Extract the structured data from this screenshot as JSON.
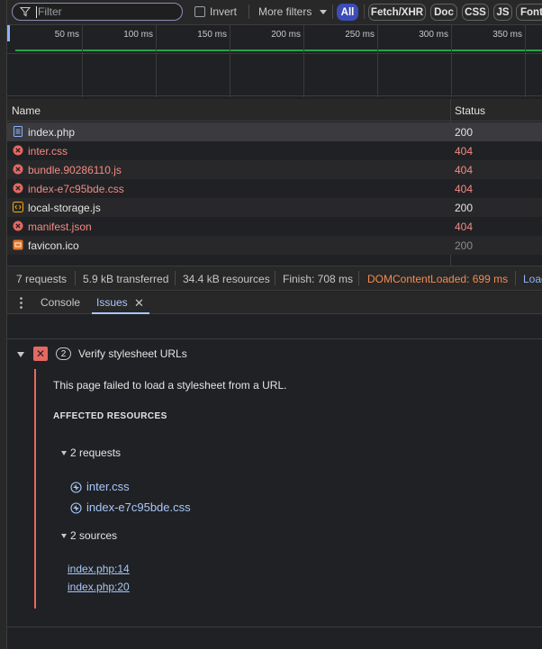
{
  "filter": {
    "placeholder": "Filter",
    "invert_label": "Invert",
    "more_filters_label": "More filters"
  },
  "type_chips": [
    "All",
    "Fetch/XHR",
    "Doc",
    "CSS",
    "JS",
    "Font"
  ],
  "timeline": {
    "ticks": [
      "50 ms",
      "100 ms",
      "150 ms",
      "200 ms",
      "250 ms",
      "300 ms",
      "350 ms"
    ]
  },
  "table": {
    "columns": [
      "Name",
      "Status"
    ],
    "rows": [
      {
        "name": "index.php",
        "status": "200",
        "icon": "document-icon"
      },
      {
        "name": "inter.css",
        "status": "404",
        "icon": "error-icon"
      },
      {
        "name": "bundle.90286110.js",
        "status": "404",
        "icon": "error-icon"
      },
      {
        "name": "index-e7c95bde.css",
        "status": "404",
        "icon": "error-icon"
      },
      {
        "name": "local-storage.js",
        "status": "200",
        "icon": "script-icon"
      },
      {
        "name": "manifest.json",
        "status": "404",
        "icon": "error-icon"
      },
      {
        "name": "favicon.ico",
        "status": "200",
        "icon": "image-icon"
      }
    ]
  },
  "summary": {
    "requests": "7 requests",
    "transferred": "5.9 kB transferred",
    "resources": "34.4 kB resources",
    "finish": "Finish: 708 ms",
    "dcl": "DOMContentLoaded: 699 ms",
    "load": "Load"
  },
  "drawer": {
    "tabs": [
      "Console",
      "Issues"
    ]
  },
  "issue": {
    "count": "2",
    "title": "Verify stylesheet URLs",
    "description": "This page failed to load a stylesheet from a URL.",
    "affected_heading": "AFFECTED RESOURCES",
    "requests_heading": "2 requests",
    "requests": [
      "inter.css",
      "index-e7c95bde.css"
    ],
    "sources_heading": "2 sources",
    "sources": [
      "index.php:14",
      "index.php:20"
    ]
  },
  "colors": {
    "accent": "#3c4db8",
    "error": "#f28b82",
    "link": "#a8c7fa",
    "ok_line": "#27a34a",
    "dcl": "#f28b52"
  }
}
